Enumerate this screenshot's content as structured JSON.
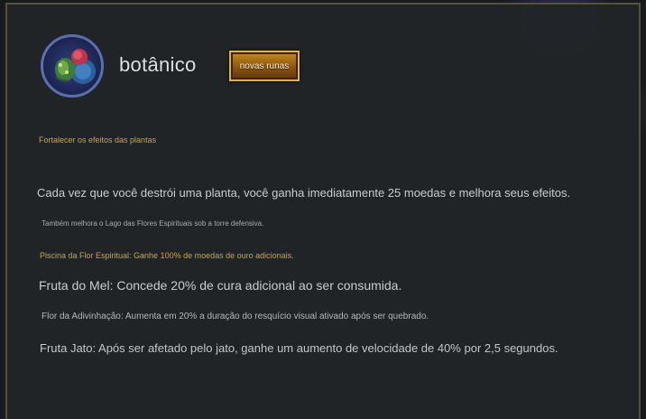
{
  "header": {
    "title": "botânico",
    "badge_label": "novas runas",
    "icon": "botanic-plants-icon"
  },
  "subtitle": "Fortalecer os efeitos das plantas",
  "description": {
    "main": "Cada vez que você destrói uma planta, você ganha imediatamente 25 moedas e melhora seus efeitos.",
    "note": "Também melhora o Lago das Flores Espirituais sob a torre defensiva.",
    "spirit_flower_pool": "Piscina da Flor Espiritual: Ganhe 100% de moedas de ouro adicionais.",
    "honey_fruit": "Fruta do Mel: Concede 20% de cura adicional ao ser consumida.",
    "divination_flower": "Flor da Adivinhação: Aumenta em 20% a duração do resquício visual ativado após ser quebrado.",
    "jet_fruit": "Fruta Jato: Após ser afetado pelo jato, ganhe um aumento de velocidade de 40% por 2,5 segundos."
  },
  "colors": {
    "gold_text": "#d5a23a",
    "body_text": "#c9ccd0",
    "badge_bg": "#8a5512",
    "panel_bg": "#212428"
  }
}
